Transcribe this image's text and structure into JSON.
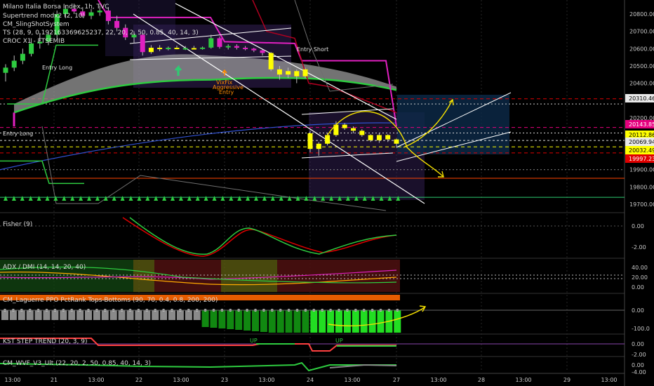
{
  "header": {
    "symbol_line": "Milano Italia Borsa Index, 1h, TVC",
    "indicators": [
      "Supertrend modx2 (2, 10)",
      "CM_SlingShotSystem",
      "TS (28, 9, 0.192163369625237, 22, 20, 2, 50, 0.85, 40, 14, 3)",
      "CROC X1 - FTSEMIB"
    ]
  },
  "price_axis": {
    "ticks": [
      "20800.00",
      "20700.00",
      "20600.00",
      "20500.00",
      "20400.00",
      "20300.00",
      "20200.00",
      "20100.00",
      "20000.00",
      "19900.00",
      "19800.00",
      "19700.00"
    ],
    "badges": [
      {
        "text": "20310.46",
        "bg": "#e8e8e8",
        "fg": "#000000",
        "value": 20310.46
      },
      {
        "text": "20143.85",
        "bg": "#e6007e",
        "fg": "#ffffff",
        "value": 20143.85
      },
      {
        "text": "20112.86",
        "bg": "#ffff00",
        "fg": "#000000",
        "value": 20112.86
      },
      {
        "text": "20069.94",
        "bg": "#e8e8e8",
        "fg": "#000000",
        "value": 20069.94
      },
      {
        "text": "20032.49",
        "bg": "#ffff00",
        "fg": "#000000",
        "value": 20032.49
      },
      {
        "text": "19997.23",
        "bg": "#e00000",
        "fg": "#ffffff",
        "value": 19997.23
      }
    ]
  },
  "time_axis": [
    "13:00",
    "21",
    "13:00",
    "22",
    "13:00",
    "23",
    "13:00",
    "24",
    "13:00",
    "27",
    "13:00",
    "28",
    "13:00",
    "29",
    "13:00"
  ],
  "annotations": {
    "entry_long_1": "Entry Long",
    "entry_long_2": "Entry Long",
    "entry_short": "Entry Short",
    "vixfix": "VixFix",
    "aggressive": "Aggressive",
    "entry": "Entry"
  },
  "panels": {
    "fisher": {
      "title": "Fisher (9)",
      "ticks": [
        "0.00",
        "-2.00"
      ]
    },
    "adx": {
      "title": "ADX / DMI (14, 14, 20, 40)",
      "ticks": [
        "40.00",
        "20.00",
        "0.00"
      ]
    },
    "laguerre": {
      "title": "CM_Laguerre PPO PctRank Tops-Bottoms (90, 70, 0.4, 0.8, 200, 200)",
      "ticks": [
        "0.00",
        "-100.0"
      ]
    },
    "kst": {
      "title": "KST STEP TREND (20, 3, 9)",
      "ticks": [
        "0.00",
        "-2.00"
      ],
      "up_labels": [
        "UP",
        "UP"
      ]
    },
    "wvf": {
      "title": "CM_WVF_V3_Ult (22, 20, 2, 50, 0.85, 40, 14, 3)",
      "ticks": [
        "0.00",
        "-4.00"
      ]
    }
  },
  "chart_data": {
    "type": "candlestick",
    "price_range": [
      19700,
      20850
    ],
    "candles": [
      {
        "o": 20460,
        "h": 20510,
        "l": 20410,
        "c": 20490
      },
      {
        "o": 20490,
        "h": 20560,
        "l": 20470,
        "c": 20530
      },
      {
        "o": 20530,
        "h": 20600,
        "l": 20510,
        "c": 20570
      },
      {
        "o": 20570,
        "h": 20660,
        "l": 20555,
        "c": 20630
      },
      {
        "o": 20630,
        "h": 20690,
        "l": 20600,
        "c": 20640
      },
      {
        "o": 20640,
        "h": 20700,
        "l": 20620,
        "c": 20680
      },
      {
        "o": 20680,
        "h": 20820,
        "l": 20660,
        "c": 20800
      },
      {
        "o": 20800,
        "h": 20850,
        "l": 20780,
        "c": 20830
      },
      {
        "o": 20830,
        "h": 20860,
        "l": 20800,
        "c": 20815
      },
      {
        "o": 20815,
        "h": 20840,
        "l": 20780,
        "c": 20790
      },
      {
        "o": 20790,
        "h": 20830,
        "l": 20770,
        "c": 20810
      },
      {
        "o": 20810,
        "h": 20850,
        "l": 20790,
        "c": 20820
      },
      {
        "o": 20820,
        "h": 20840,
        "l": 20740,
        "c": 20760
      },
      {
        "o": 20760,
        "h": 20790,
        "l": 20700,
        "c": 20720
      },
      {
        "o": 20720,
        "h": 20740,
        "l": 20650,
        "c": 20665
      },
      {
        "o": 20665,
        "h": 20700,
        "l": 20630,
        "c": 20680
      },
      {
        "o": 20680,
        "h": 20690,
        "l": 20560,
        "c": 20580
      },
      {
        "o": 20580,
        "h": 20620,
        "l": 20570,
        "c": 20605
      },
      {
        "o": 20605,
        "h": 20620,
        "l": 20585,
        "c": 20598
      },
      {
        "o": 20598,
        "h": 20612,
        "l": 20590,
        "c": 20605
      },
      {
        "o": 20605,
        "h": 20618,
        "l": 20596,
        "c": 20600
      },
      {
        "o": 20600,
        "h": 20615,
        "l": 20592,
        "c": 20603
      },
      {
        "o": 20603,
        "h": 20616,
        "l": 20595,
        "c": 20598
      },
      {
        "o": 20598,
        "h": 20612,
        "l": 20594,
        "c": 20606
      },
      {
        "o": 20606,
        "h": 20680,
        "l": 20600,
        "c": 20660
      },
      {
        "o": 20660,
        "h": 20670,
        "l": 20600,
        "c": 20610
      },
      {
        "o": 20610,
        "h": 20625,
        "l": 20595,
        "c": 20615
      },
      {
        "o": 20615,
        "h": 20625,
        "l": 20595,
        "c": 20605
      },
      {
        "o": 20605,
        "h": 20615,
        "l": 20590,
        "c": 20600
      },
      {
        "o": 20600,
        "h": 20605,
        "l": 20580,
        "c": 20590
      },
      {
        "o": 20590,
        "h": 20595,
        "l": 20560,
        "c": 20575
      },
      {
        "o": 20575,
        "h": 20580,
        "l": 20470,
        "c": 20480
      },
      {
        "o": 20480,
        "h": 20500,
        "l": 20420,
        "c": 20450
      },
      {
        "o": 20450,
        "h": 20490,
        "l": 20430,
        "c": 20470
      },
      {
        "o": 20470,
        "h": 20480,
        "l": 20400,
        "c": 20440
      },
      {
        "o": 20440,
        "h": 20490,
        "l": 20430,
        "c": 20480
      },
      {
        "o": 20110,
        "h": 20125,
        "l": 20000,
        "c": 20020
      },
      {
        "o": 20020,
        "h": 20060,
        "l": 19980,
        "c": 20050
      },
      {
        "o": 20050,
        "h": 20110,
        "l": 20040,
        "c": 20100
      },
      {
        "o": 20100,
        "h": 20180,
        "l": 20090,
        "c": 20160
      },
      {
        "o": 20160,
        "h": 20170,
        "l": 20130,
        "c": 20140
      },
      {
        "o": 20140,
        "h": 20150,
        "l": 20110,
        "c": 20125
      },
      {
        "o": 20125,
        "h": 20135,
        "l": 20090,
        "c": 20100
      },
      {
        "o": 20100,
        "h": 20105,
        "l": 20060,
        "c": 20070
      },
      {
        "o": 20070,
        "h": 20110,
        "l": 20055,
        "c": 20100
      },
      {
        "o": 20100,
        "h": 20105,
        "l": 20060,
        "c": 20075
      },
      {
        "o": 20075,
        "h": 20080,
        "l": 20030,
        "c": 20050
      }
    ]
  }
}
